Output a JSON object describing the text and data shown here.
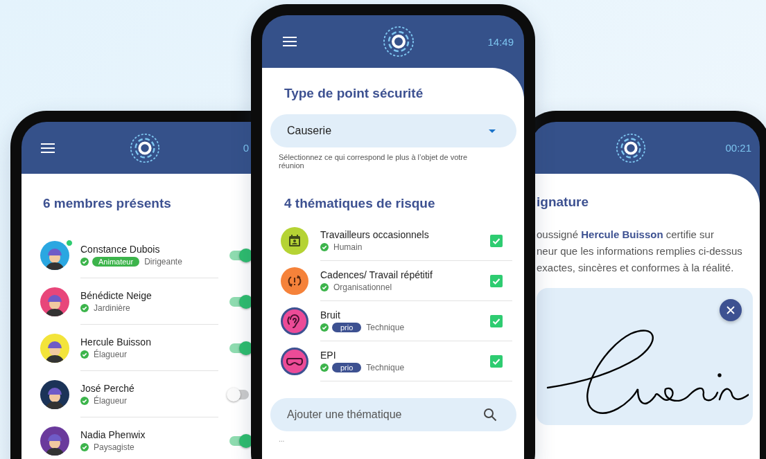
{
  "member_screen": {
    "time": "0",
    "title": "6 membres présents",
    "members": [
      {
        "name": "Constance Dubois",
        "badge": "Animateur",
        "role": "Dirigeante",
        "color": "#2aa7e1",
        "online": true,
        "present": true
      },
      {
        "name": "Bénédicte Neige",
        "role": "Jardinière",
        "color": "#e8467a",
        "online": false,
        "present": true
      },
      {
        "name": "Hercule Buisson",
        "role": "Élagueur",
        "color": "#f3e43a",
        "online": false,
        "present": true
      },
      {
        "name": "José Perché",
        "role": "Élagueur",
        "color": "#1b3358",
        "online": false,
        "present": false
      },
      {
        "name": "Nadia Phenwix",
        "role": "Paysagiste",
        "color": "#6a3a9c",
        "online": false,
        "present": true
      }
    ]
  },
  "type_screen": {
    "time": "14:49",
    "title": "Type de point sécurité",
    "type_select": {
      "value": "Causerie"
    },
    "helper": "Sélectionnez ce qui correspond le plus à l’objet de votre réunion",
    "risks_title": "4 thématiques de risque",
    "risks": [
      {
        "kind": "calendar",
        "color": "#b5d334",
        "outlined": false,
        "title": "Travailleurs occasionnels",
        "category": "Humain",
        "checked": true
      },
      {
        "kind": "cycle",
        "color": "#f5823a",
        "outlined": false,
        "title": "Cadences/ Travail répétitif",
        "category": "Organisationnel",
        "checked": true
      },
      {
        "kind": "ear",
        "color": "#ec4b97",
        "outlined": true,
        "title": "Bruit",
        "badge": "prio",
        "category": "Technique",
        "checked": true
      },
      {
        "kind": "goggles",
        "color": "#ec4b97",
        "outlined": true,
        "title": "EPI",
        "badge": "prio",
        "category": "Technique",
        "checked": true
      }
    ],
    "search": {
      "placeholder": "Ajouter une thématique"
    },
    "more": "..."
  },
  "signature_screen": {
    "time": "00:21",
    "title": "ignature",
    "statement_lines": [
      "oussigné **Hercule Buisson** certifie sur",
      "neur que les informations remplies ci-dessus",
      "exactes, sincères et conformes à la réalité."
    ],
    "signature": {
      "signed": true
    }
  }
}
